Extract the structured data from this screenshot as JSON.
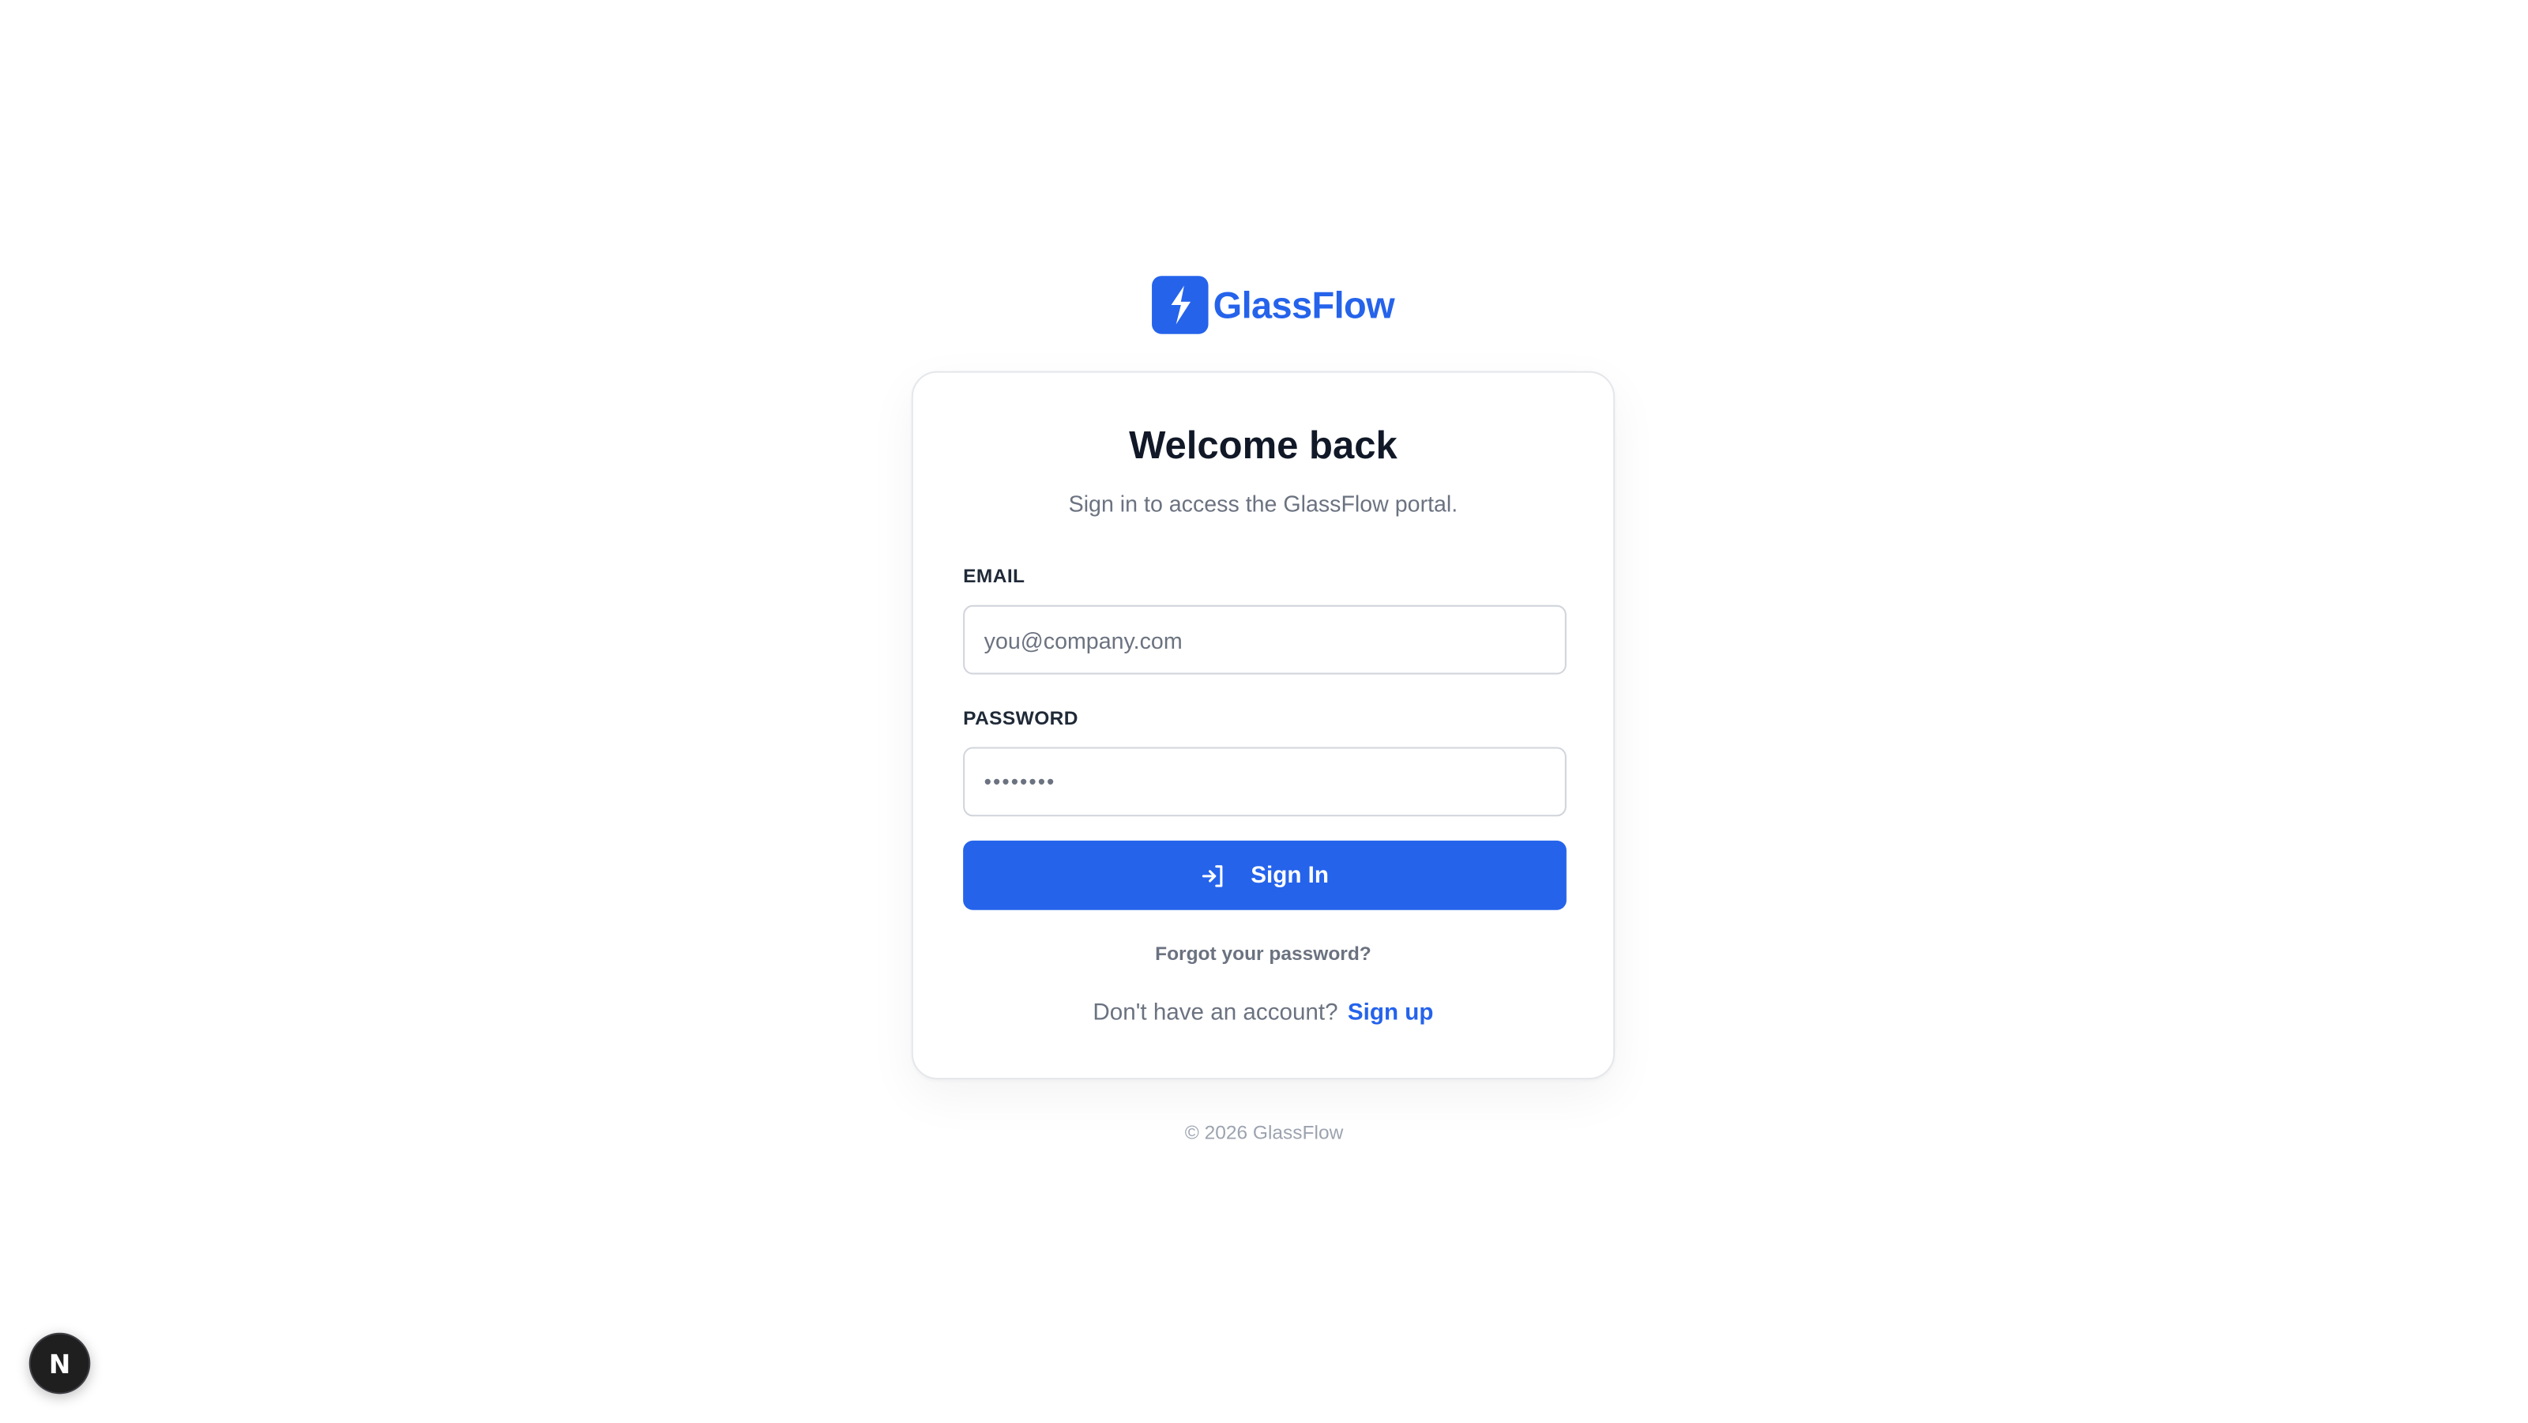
{
  "brand": {
    "name": "GlassFlow",
    "logo_icon": "lightning-bolt-icon",
    "color": "#2563eb"
  },
  "card": {
    "title": "Welcome back",
    "subtitle": "Sign in to access the GlassFlow portal."
  },
  "form": {
    "email_label": "EMAIL",
    "email_placeholder": "you@company.com",
    "email_value": "",
    "password_label": "PASSWORD",
    "password_value": "••••••••",
    "submit_label": "Sign In",
    "submit_icon": "sign-in-arrow-icon"
  },
  "links": {
    "forgot_password": "Forgot your password?",
    "no_account_text": "Don't have an account?",
    "signup_label": "Sign up"
  },
  "footer": {
    "copyright": "© 2026 GlassFlow"
  },
  "dev_badge": {
    "letter": "N",
    "icon": "nextjs-dev-indicator-icon"
  },
  "colors": {
    "accent": "#2563eb",
    "heading": "#111827",
    "muted": "#6b7280",
    "border": "#d1d5db"
  }
}
